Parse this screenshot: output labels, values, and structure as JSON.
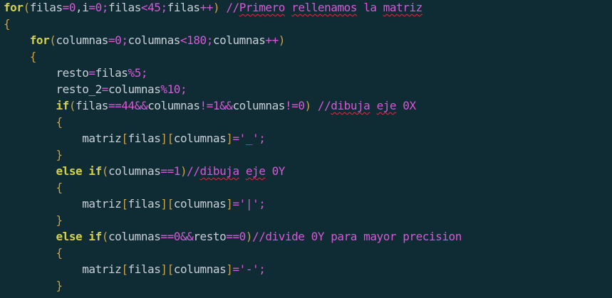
{
  "editor": {
    "colors": {
      "background": "#0f2b33",
      "keyword": "#d6d34a",
      "identifier": "#c8d0d8",
      "bracket": "#c9a24a",
      "number": "#d65ad6",
      "operator": "#d65ad6",
      "string": "#d65ad6",
      "comment": "#d65ad6",
      "spellcheck_underline": "#e0303a"
    },
    "lines": [
      {
        "tokens": [
          {
            "t": "for",
            "k": "kw"
          },
          {
            "t": "(",
            "k": "br"
          },
          {
            "t": "filas",
            "k": "id"
          },
          {
            "t": "=",
            "k": "op"
          },
          {
            "t": "0",
            "k": "num"
          },
          {
            "t": ",",
            "k": "id"
          },
          {
            "t": "i",
            "k": "id"
          },
          {
            "t": "=",
            "k": "op"
          },
          {
            "t": "0",
            "k": "num"
          },
          {
            "t": ";",
            "k": "op"
          },
          {
            "t": "filas",
            "k": "id"
          },
          {
            "t": "<",
            "k": "op"
          },
          {
            "t": "45",
            "k": "num"
          },
          {
            "t": ";",
            "k": "op"
          },
          {
            "t": "filas",
            "k": "id"
          },
          {
            "t": "++",
            "k": "op"
          },
          {
            "t": ")",
            "k": "br"
          },
          {
            "t": " //",
            "k": "cm"
          },
          {
            "t": "Primero",
            "k": "cm sp"
          },
          {
            "t": " ",
            "k": "cm"
          },
          {
            "t": "rellenamos",
            "k": "cm sp"
          },
          {
            "t": " la ",
            "k": "cm"
          },
          {
            "t": "matriz",
            "k": "cm sp"
          }
        ]
      },
      {
        "tokens": [
          {
            "t": "{",
            "k": "br"
          }
        ]
      },
      {
        "tokens": [
          {
            "t": "    ",
            "k": "id"
          },
          {
            "t": "for",
            "k": "kw"
          },
          {
            "t": "(",
            "k": "br"
          },
          {
            "t": "columnas",
            "k": "id"
          },
          {
            "t": "=",
            "k": "op"
          },
          {
            "t": "0",
            "k": "num"
          },
          {
            "t": ";",
            "k": "op"
          },
          {
            "t": "columnas",
            "k": "id"
          },
          {
            "t": "<",
            "k": "op"
          },
          {
            "t": "180",
            "k": "num"
          },
          {
            "t": ";",
            "k": "op"
          },
          {
            "t": "columnas",
            "k": "id"
          },
          {
            "t": "++",
            "k": "op"
          },
          {
            "t": ")",
            "k": "br"
          }
        ]
      },
      {
        "tokens": [
          {
            "t": "    ",
            "k": "id"
          },
          {
            "t": "{",
            "k": "br"
          }
        ]
      },
      {
        "tokens": [
          {
            "t": "        ",
            "k": "id"
          },
          {
            "t": "resto",
            "k": "id"
          },
          {
            "t": "=",
            "k": "op"
          },
          {
            "t": "filas",
            "k": "id"
          },
          {
            "t": "%",
            "k": "op"
          },
          {
            "t": "5",
            "k": "num"
          },
          {
            "t": ";",
            "k": "op"
          }
        ]
      },
      {
        "tokens": [
          {
            "t": "        ",
            "k": "id"
          },
          {
            "t": "resto_2",
            "k": "id"
          },
          {
            "t": "=",
            "k": "op"
          },
          {
            "t": "columnas",
            "k": "id"
          },
          {
            "t": "%",
            "k": "op"
          },
          {
            "t": "10",
            "k": "num"
          },
          {
            "t": ";",
            "k": "op"
          }
        ]
      },
      {
        "tokens": [
          {
            "t": "        ",
            "k": "id"
          },
          {
            "t": "if",
            "k": "kw"
          },
          {
            "t": "(",
            "k": "br"
          },
          {
            "t": "filas",
            "k": "id"
          },
          {
            "t": "==",
            "k": "op"
          },
          {
            "t": "44",
            "k": "num"
          },
          {
            "t": "&&",
            "k": "op"
          },
          {
            "t": "columnas",
            "k": "id"
          },
          {
            "t": "!=",
            "k": "op"
          },
          {
            "t": "1",
            "k": "num"
          },
          {
            "t": "&&",
            "k": "op"
          },
          {
            "t": "columnas",
            "k": "id"
          },
          {
            "t": "!=",
            "k": "op"
          },
          {
            "t": "0",
            "k": "num"
          },
          {
            "t": ")",
            "k": "br"
          },
          {
            "t": " //",
            "k": "cm"
          },
          {
            "t": "dibuja",
            "k": "cm sp"
          },
          {
            "t": " ",
            "k": "cm"
          },
          {
            "t": "eje",
            "k": "cm sp"
          },
          {
            "t": " 0X",
            "k": "cm"
          }
        ]
      },
      {
        "tokens": [
          {
            "t": "        ",
            "k": "id"
          },
          {
            "t": "{",
            "k": "br"
          }
        ]
      },
      {
        "tokens": [
          {
            "t": "            ",
            "k": "id"
          },
          {
            "t": "matriz",
            "k": "id"
          },
          {
            "t": "[",
            "k": "br"
          },
          {
            "t": "filas",
            "k": "id"
          },
          {
            "t": "][",
            "k": "br"
          },
          {
            "t": "columnas",
            "k": "id"
          },
          {
            "t": "]",
            "k": "br"
          },
          {
            "t": "=",
            "k": "op"
          },
          {
            "t": "'_'",
            "k": "str"
          },
          {
            "t": ";",
            "k": "op"
          }
        ]
      },
      {
        "tokens": [
          {
            "t": "        ",
            "k": "id"
          },
          {
            "t": "}",
            "k": "br"
          }
        ]
      },
      {
        "tokens": [
          {
            "t": "        ",
            "k": "id"
          },
          {
            "t": "else",
            "k": "kw"
          },
          {
            "t": " ",
            "k": "id"
          },
          {
            "t": "if",
            "k": "kw"
          },
          {
            "t": "(",
            "k": "br"
          },
          {
            "t": "columnas",
            "k": "id"
          },
          {
            "t": "==",
            "k": "op"
          },
          {
            "t": "1",
            "k": "num"
          },
          {
            "t": ")",
            "k": "br"
          },
          {
            "t": "//",
            "k": "cm"
          },
          {
            "t": "dibuja",
            "k": "cm sp"
          },
          {
            "t": " ",
            "k": "cm"
          },
          {
            "t": "eje",
            "k": "cm sp"
          },
          {
            "t": " 0Y",
            "k": "cm"
          }
        ]
      },
      {
        "tokens": [
          {
            "t": "        ",
            "k": "id"
          },
          {
            "t": "{",
            "k": "br"
          }
        ]
      },
      {
        "tokens": [
          {
            "t": "            ",
            "k": "id"
          },
          {
            "t": "matriz",
            "k": "id"
          },
          {
            "t": "[",
            "k": "br"
          },
          {
            "t": "filas",
            "k": "id"
          },
          {
            "t": "][",
            "k": "br"
          },
          {
            "t": "columnas",
            "k": "id"
          },
          {
            "t": "]",
            "k": "br"
          },
          {
            "t": "=",
            "k": "op"
          },
          {
            "t": "'|'",
            "k": "str"
          },
          {
            "t": ";",
            "k": "op"
          }
        ]
      },
      {
        "tokens": [
          {
            "t": "        ",
            "k": "id"
          },
          {
            "t": "}",
            "k": "br"
          }
        ]
      },
      {
        "tokens": [
          {
            "t": "        ",
            "k": "id"
          },
          {
            "t": "else",
            "k": "kw"
          },
          {
            "t": " ",
            "k": "id"
          },
          {
            "t": "if",
            "k": "kw"
          },
          {
            "t": "(",
            "k": "br"
          },
          {
            "t": "columnas",
            "k": "id"
          },
          {
            "t": "==",
            "k": "op"
          },
          {
            "t": "0",
            "k": "num"
          },
          {
            "t": "&&",
            "k": "op"
          },
          {
            "t": "resto",
            "k": "id"
          },
          {
            "t": "==",
            "k": "op"
          },
          {
            "t": "0",
            "k": "num"
          },
          {
            "t": ")",
            "k": "br"
          },
          {
            "t": "//divide 0Y para mayor precision",
            "k": "cm"
          }
        ]
      },
      {
        "tokens": [
          {
            "t": "        ",
            "k": "id"
          },
          {
            "t": "{",
            "k": "br"
          }
        ]
      },
      {
        "tokens": [
          {
            "t": "            ",
            "k": "id"
          },
          {
            "t": "matriz",
            "k": "id"
          },
          {
            "t": "[",
            "k": "br"
          },
          {
            "t": "filas",
            "k": "id"
          },
          {
            "t": "][",
            "k": "br"
          },
          {
            "t": "columnas",
            "k": "id"
          },
          {
            "t": "]",
            "k": "br"
          },
          {
            "t": "=",
            "k": "op"
          },
          {
            "t": "'-'",
            "k": "str"
          },
          {
            "t": ";",
            "k": "op"
          }
        ]
      },
      {
        "tokens": [
          {
            "t": "        ",
            "k": "id"
          },
          {
            "t": "}",
            "k": "br"
          }
        ]
      }
    ]
  }
}
